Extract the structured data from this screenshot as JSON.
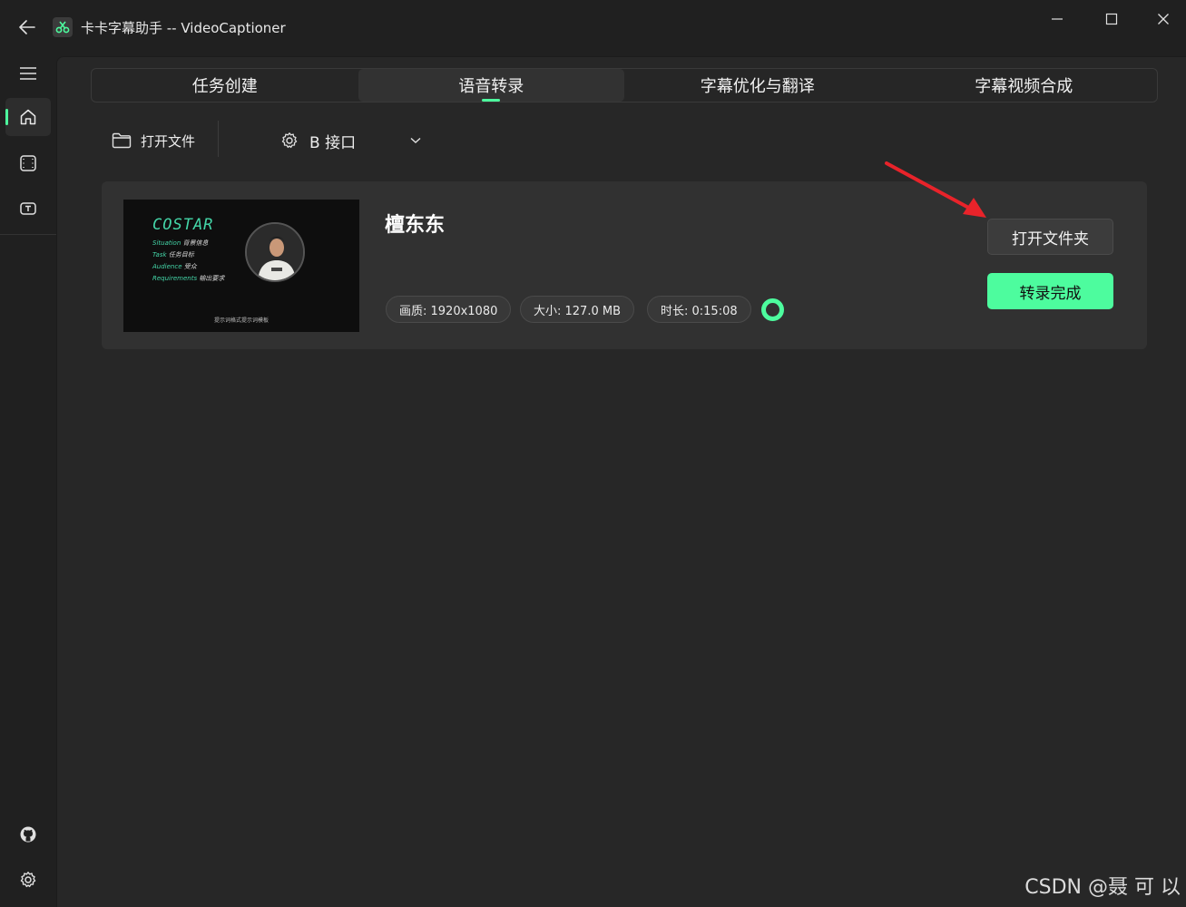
{
  "window": {
    "title": "卡卡字幕助手 -- VideoCaptioner"
  },
  "tabs": [
    {
      "label": "任务创建",
      "active": false
    },
    {
      "label": "语音转录",
      "active": true
    },
    {
      "label": "字幕优化与翻译",
      "active": false
    },
    {
      "label": "字幕视频合成",
      "active": false
    }
  ],
  "toolbar": {
    "open_file_label": "打开文件",
    "engine_label": "B 接口"
  },
  "card": {
    "title": "檀东东",
    "thumbnail": {
      "heading": "COSTAR",
      "lines": [
        {
          "key": "Situation",
          "text": "背景信息"
        },
        {
          "key": "Task",
          "text": "任务目标"
        },
        {
          "key": "Audience",
          "text": "受众"
        },
        {
          "key": "Requirements",
          "text": "输出要求"
        }
      ],
      "footer": "提示词格式提示词模板"
    },
    "chips": {
      "resolution": "画质: 1920x1080",
      "size": "大小: 127.0 MB",
      "duration": "时长: 0:15:08"
    },
    "open_folder_label": "打开文件夹",
    "status_label": "转录完成"
  },
  "colors": {
    "accent": "#4dfc9e",
    "background": "#202020",
    "panel": "#272727",
    "card": "#313131",
    "annotation_arrow": "#e8232a"
  },
  "watermark": "CSDN @聂 可 以"
}
